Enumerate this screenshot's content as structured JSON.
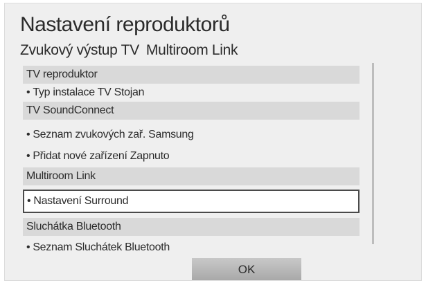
{
  "title": "Nastavení reproduktorů",
  "subtitle": {
    "part1": "Zvukový výstup TV",
    "part2": "Multiroom Link"
  },
  "sections": {
    "tv_speaker": {
      "header": "TV reproduktor",
      "items": [
        {
          "label": "Typ instalace TV",
          "value": "Stojan"
        }
      ]
    },
    "soundconnect": {
      "header": "TV SoundConnect",
      "items": [
        {
          "label": "Seznam zvukových zař. Samsung"
        },
        {
          "label": "Přidat nové zařízení",
          "value": "Zapnuto"
        }
      ]
    },
    "multiroom": {
      "header": "Multiroom Link",
      "items": [
        {
          "label": "Nastavení Surround"
        }
      ]
    },
    "bluetooth": {
      "header": "Sluchátka Bluetooth",
      "items": [
        {
          "label": "Seznam Sluchátek Bluetooth"
        }
      ]
    }
  },
  "bullet": "•",
  "ok_label": "OK"
}
